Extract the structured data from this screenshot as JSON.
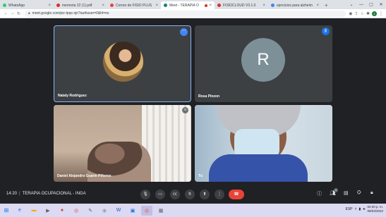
{
  "browser": {
    "tabs": [
      {
        "label": "WhatsApp",
        "favicon_color": "#25d366",
        "active": false
      },
      {
        "label": "memoria 22 (1).pdf",
        "favicon_color": "#d93025",
        "active": false
      },
      {
        "label": "Correo de FISIO PLUS",
        "favicon_color": "#ea4335",
        "active": false
      },
      {
        "label": "Meet - TERAPIA O",
        "favicon_color": "#00897b",
        "active": true
      },
      {
        "label": "FISIOCLOUD V3.1.0",
        "favicon_color": "#d93025",
        "active": false
      },
      {
        "label": "ejercicios para alzheim",
        "favicon_color": "#4285f4",
        "active": false
      }
    ],
    "url": "meet.google.com/piz-tpqx-sjn?authuser=0&hl=es",
    "profile_initial": "1"
  },
  "participants": {
    "nataly": "Nataly Rodriguez",
    "rosa": "Rosa Pinzon",
    "rosa_initial": "R",
    "daniel": "Daniel Alejandro Guarin Piñeros",
    "tu": "Tú"
  },
  "meeting": {
    "time": "14:20",
    "separator": "|",
    "title": "TERAPIA OCUPACIONAL - INGA",
    "participant_count": "4"
  },
  "taskbar": {
    "clock_time": "02:20 p. m.",
    "clock_date": "08/03/2022",
    "language": "ESP"
  },
  "colors": {
    "hangup": "#ea4335",
    "active_border": "#8ab4f8",
    "avatar_r": "#7d9098"
  }
}
